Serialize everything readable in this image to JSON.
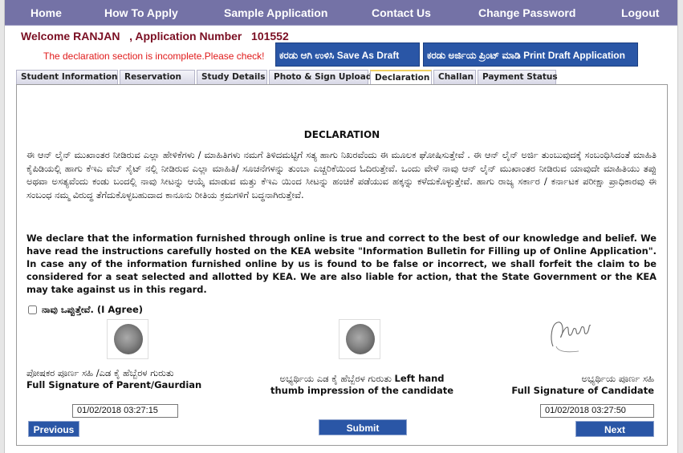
{
  "nav": {
    "items": [
      "Home",
      "How To Apply",
      "Sample Application",
      "Contact Us",
      "Change Password",
      "Logout"
    ]
  },
  "header": {
    "welcome_text": "Welcome RANJAN   , Application Number   101552",
    "warning": "The declaration section is incomplete.Please check!",
    "save_draft_label": "ಕರಡು ಆಗಿ ಉಳಿಸಿ  Save As Draft",
    "print_draft_label": "ಕರಡು ಅರ್ಜಿಯ ಪ್ರಿಂಟ್ ಮಾಡಿ  Print Draft Application"
  },
  "tabs": [
    {
      "label": "Student Information",
      "active": false
    },
    {
      "label": "Reservation",
      "active": false
    },
    {
      "label": "Study Details",
      "active": false
    },
    {
      "label": "Photo & Sign Upload",
      "active": false
    },
    {
      "label": "Declaration",
      "active": true
    },
    {
      "label": "Challan",
      "active": false
    },
    {
      "label": "Payment Status",
      "active": false
    }
  ],
  "declaration": {
    "title": "DECLARATION",
    "kannada_text": "ಈ ಆನ್ ಲೈನ್ ಮುಖಾಂತರ ನೀಡಿರುವ ಎಲ್ಲಾ ಹೇಳಿಕೆಗಳು / ಮಾಹಿತಿಗಳು ನಮಗೆ ತಿಳಿದಮಟ್ಟಿಗೆ ಸತ್ಯ ಹಾಗು ನಿಖರವೆಂದು ಈ ಮೂಲಕ ಘೋಷಿಸುತ್ತೇವೆ . ಈ ಆನ್ ಲೈನ್ ಅರ್ಜಿ ತುಂಬುವುದಕ್ಕೆ ಸಂಬಂಧಿಸಿದಂತೆ ಮಾಹಿತಿ ಕೈಪಿಡಿಯಲ್ಲಿ ಹಾಗು ಕೆಇಎ ವೆಬ್ ಸೈಟ್ ನಲ್ಲಿ ನೀಡಿರುವ ಎಲ್ಲಾ ಮಾಹಿತಿ/ ಸೂಚನೆಗಳನ್ನು ತುಂಬಾ ಎಚ್ಚರಿಕೆಯಿಂದ ಓದಿರುತ್ತೇವೆ. ಒಂದು ವೇಳೆ ನಾವು ಆನ್ ಲೈನ್ ಮುಖಾಂತರ ನೀಡಿರುವ ಯಾವುದೇ ಮಾಹಿತಿಯು ತಪ್ಪು ಅಥವಾ ಅಸತ್ಯವೆಂದು ಕಂಡು ಬಂದಲ್ಲಿ ನಾವು ಸೀಟನ್ನು ಆಯ್ಕೆ ಮಾಡುವ ಮತ್ತು ಕೆಇಎ ಯಿಂದ ಸೀಟನ್ನು ಹಂಚಿಕೆ ಪಡೆಯುವ ಹಕ್ಕನ್ನು ಕಳೆದುಕೊಳ್ಳುತ್ತೇವೆ. ಹಾಗು ರಾಜ್ಯ ಸರ್ಕಾರ / ಕರ್ನಾಟಕ ಪರೀಕ್ಷಾ ಪ್ರಾಧಿಕಾರವು ಈ ಸಂಬಂಧ ನಮ್ಮ ವಿರುದ್ಧ ತೆಗೆದುಕೊಳ್ಳಬಹುದಾದ ಕಾನೂನು ರೀತಿಯ ಕ್ರಮಗಳಿಗೆ ಬದ್ಧನಾಗಿರುತ್ತೇವೆ.",
    "english_text": "We declare that the information furnished through online is true and correct to the best of our knowledge and belief. We have read the instructions carefully hosted on the KEA website \"Information Bulletin for Filling up of Online Application\". In case any of the information furnished online by us is found to be false or incorrect, we shall forfeit the claim to be considered for a seat selected and allotted by KEA. We are also liable for action, that the State Government or the KEA may take against us in this regard.",
    "agree_label": "ನಾವು ಒಪ್ಪುತ್ತೇವೆ.  (I Agree)",
    "agree_checked": false
  },
  "signatures": {
    "parent": {
      "label_kn": "ಪೋಷಕರ ಪೂರ್ಣ ಸಹಿ /ಎಡ ಕೈ ಹೆಬ್ಬೆರಳ ಗುರುತು",
      "label_en": "Full Signature of Parent/Gaurdian",
      "date": "01/02/2018 03:27:15"
    },
    "thumb": {
      "label_kn": "ಅಭ್ಯರ್ಥಿಯ ಎಡ ಕೈ ಹೆಬ್ಬೆರಳ ಗುರುತು",
      "label_en_1": "Left hand",
      "label_en_2": "thumb impression of the candidate"
    },
    "candidate": {
      "label_kn": "ಅಭ್ಯರ್ಥಿಯ ಪೂರ್ಣ ಸಹಿ",
      "label_en": "Full Signature of Candidate",
      "date": "01/02/2018 03:27:50",
      "signature_text": "Mjadhade"
    }
  },
  "buttons": {
    "previous": "Previous",
    "submit": "Submit",
    "next": "Next"
  },
  "colors": {
    "nav_bg": "#7472a6",
    "button_bg": "#2a56a6",
    "warning": "#e01a1a",
    "welcome": "#7a0e22"
  }
}
